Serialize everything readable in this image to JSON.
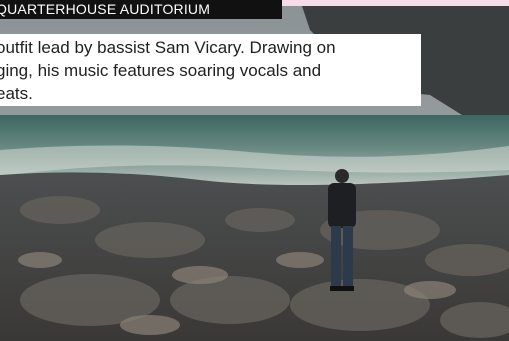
{
  "venue": {
    "name": "QUARTERHOUSE AUDITORIUM"
  },
  "description": {
    "text": "outfit lead by bassist Sam Vicary. Drawing on\nging, his music features soaring vocals and\neats."
  },
  "photo": {
    "subject": "person standing on rocky shoreline facing the sea"
  },
  "colors": {
    "banner_bg": "#111111",
    "card_bg": "#ffffff",
    "accent_pink": "#f6dce9"
  }
}
